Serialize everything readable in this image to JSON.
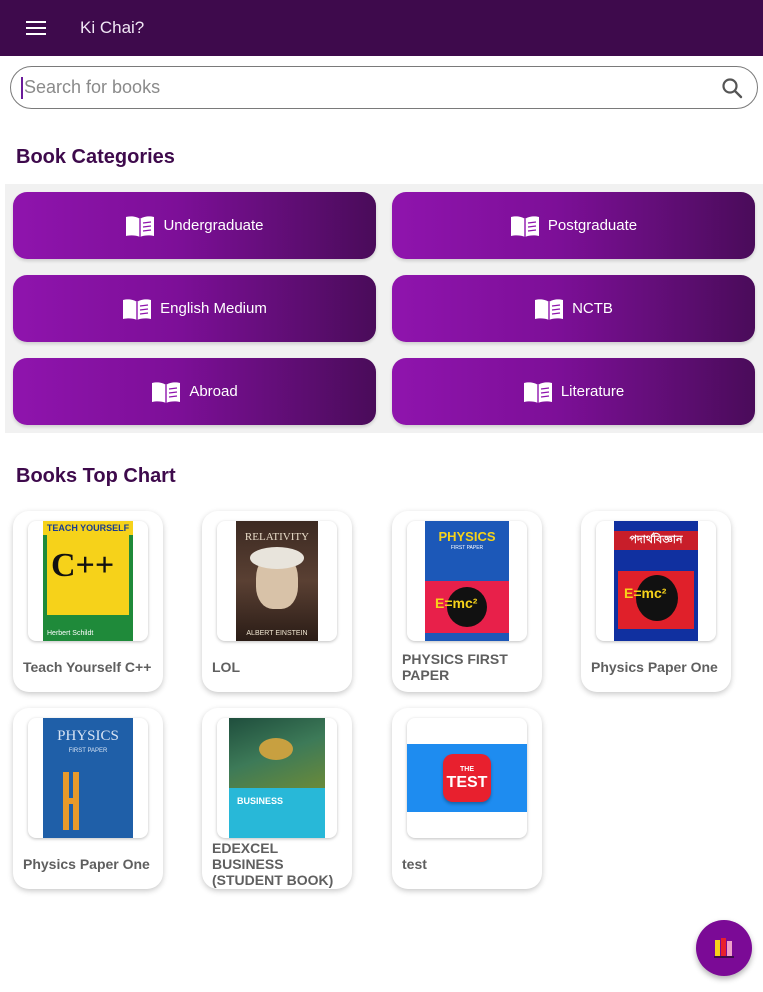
{
  "app": {
    "title": "Ki Chai?"
  },
  "search": {
    "placeholder": "Search for books",
    "value": ""
  },
  "categories": {
    "heading": "Book Categories",
    "items": [
      {
        "label": "Undergraduate"
      },
      {
        "label": "Postgraduate"
      },
      {
        "label": "English Medium"
      },
      {
        "label": "NCTB"
      },
      {
        "label": "Abroad"
      },
      {
        "label": "Literature"
      }
    ]
  },
  "top_chart": {
    "heading": "Books Top Chart",
    "books": [
      {
        "title": "Teach Yourself C++",
        "cover_text": "TEACH YOURSELF",
        "cover_big": "C++",
        "cover_author": "Herbert Schildt"
      },
      {
        "title": "LOL",
        "cover_text": "RELATIVITY",
        "cover_author": "ALBERT EINSTEIN"
      },
      {
        "title": "PHYSICS FIRST PAPER",
        "cover_text": "PHYSICS",
        "cover_sub": "FIRST PAPER",
        "cover_big": "E=mc²"
      },
      {
        "title": "Physics Paper One",
        "cover_text": "পদার্থবিজ্ঞান",
        "cover_big": "E=mc²"
      },
      {
        "title": "Physics Paper One",
        "cover_text": "PHYSICS",
        "cover_sub": "FIRST PAPER"
      },
      {
        "title": "EDEXCEL BUSINESS (STUDENT BOOK)",
        "cover_text": "BUSINESS"
      },
      {
        "title": "test",
        "cover_text": "THE",
        "cover_big": "TEST"
      }
    ]
  },
  "colors": {
    "appbar": "#3e0a4c",
    "accent": "#7b0a96",
    "heading": "#3e0a4c"
  },
  "icons": {
    "menu": "hamburger-icon",
    "search": "search-icon",
    "category": "open-book-icon",
    "fab": "books-icon"
  }
}
